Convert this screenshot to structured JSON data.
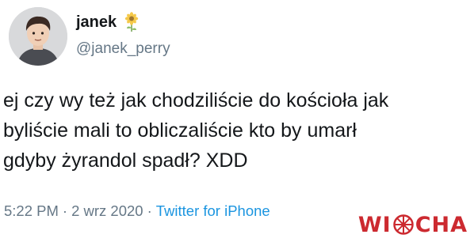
{
  "user": {
    "display_name": "janek",
    "handle": "@janek_perry",
    "avatar": "cartoon-avatar-icon",
    "name_emoji": "sunflower-icon"
  },
  "tweet": {
    "lines": [
      "ej czy wy też jak chodziliście do kościoła jak",
      "byliście mali to obliczaliście kto by umarł",
      "gdyby żyrandol spadł? XDD"
    ]
  },
  "meta": {
    "time": "5:22 PM",
    "separator": "·",
    "date": "2 wrz 2020",
    "source": "Twitter for iPhone"
  },
  "watermark": {
    "text_left": "WI",
    "text_right": "CHA",
    "icon": "compass-wheel-icon"
  },
  "colors": {
    "text": "#14171a",
    "secondary": "#657786",
    "link": "#1b95e0",
    "watermark": "#cc2a30"
  }
}
